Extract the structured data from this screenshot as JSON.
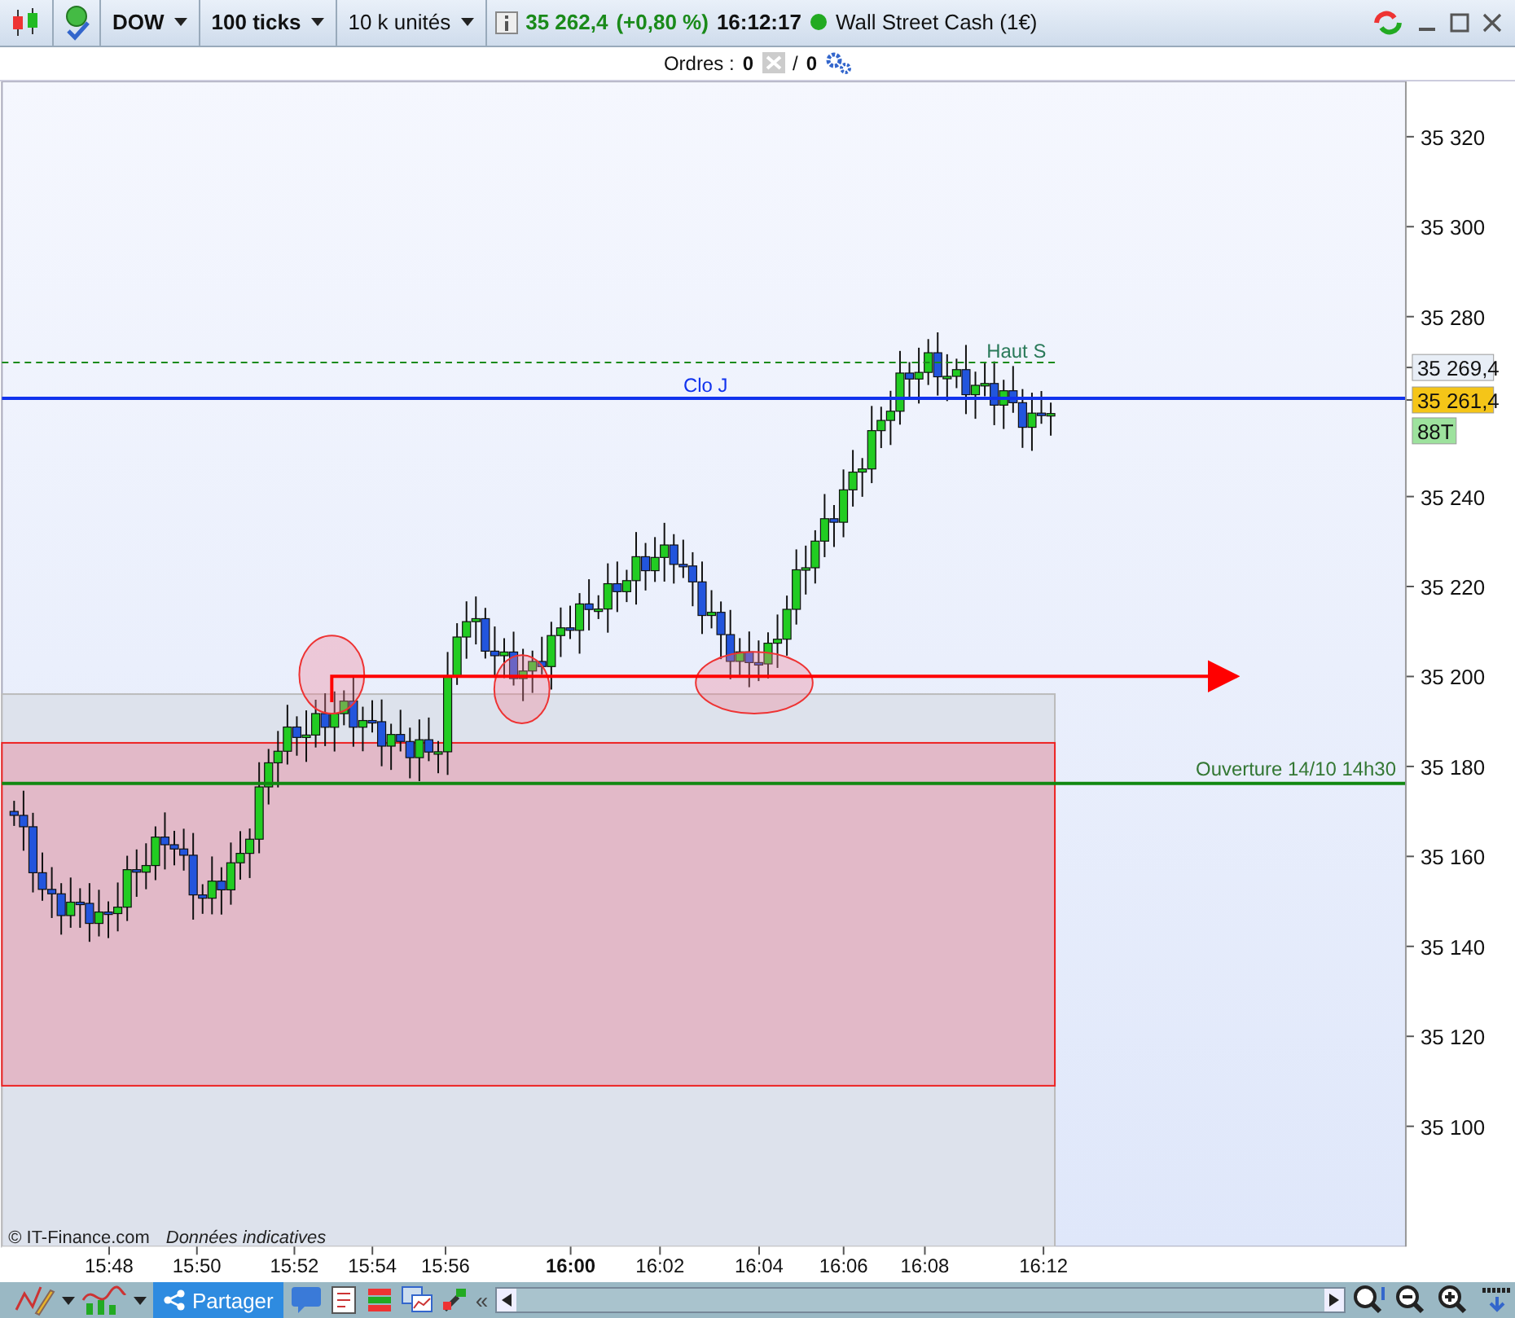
{
  "toolbar": {
    "instrument": "DOW",
    "period": "100 ticks",
    "units": "10 k unités",
    "price": "35 262,4",
    "change": "(+0,80 %)",
    "time": "16:12:17",
    "market": "Wall Street Cash (1€)"
  },
  "orders": {
    "label": "Ordres :",
    "count": "0",
    "separator": "/",
    "pending": "0"
  },
  "chart": {
    "y_ticks": [
      "35 320",
      "35 300",
      "35 280",
      "35 240",
      "35 220",
      "35 200",
      "35 180",
      "35 160",
      "35 140",
      "35 120",
      "35 100"
    ],
    "x_ticks": [
      {
        "label": "15:48",
        "major": false
      },
      {
        "label": "15:50",
        "major": false
      },
      {
        "label": "15:52",
        "major": false
      },
      {
        "label": "15:54",
        "major": false
      },
      {
        "label": "15:56",
        "major": false
      },
      {
        "label": "16:00",
        "major": true
      },
      {
        "label": "16:02",
        "major": false
      },
      {
        "label": "16:04",
        "major": false
      },
      {
        "label": "16:06",
        "major": false
      },
      {
        "label": "16:08",
        "major": false
      },
      {
        "label": "16:12",
        "major": false
      }
    ],
    "lines": [
      {
        "kind": "close",
        "label": "Clo J"
      },
      {
        "kind": "high",
        "label": "Haut S"
      },
      {
        "kind": "open",
        "label": "Ouverture 14/10 14h30"
      }
    ],
    "price_labels": [
      {
        "kind": "high",
        "text": "35 269,4"
      },
      {
        "kind": "last",
        "text": "35 261,4"
      },
      {
        "kind": "ticks",
        "text": "88T"
      }
    ],
    "copyright": "© IT-Finance.com",
    "note": "Données indicatives"
  },
  "bottom_toolbar": {
    "share": "Partager",
    "collapse": "«"
  }
}
